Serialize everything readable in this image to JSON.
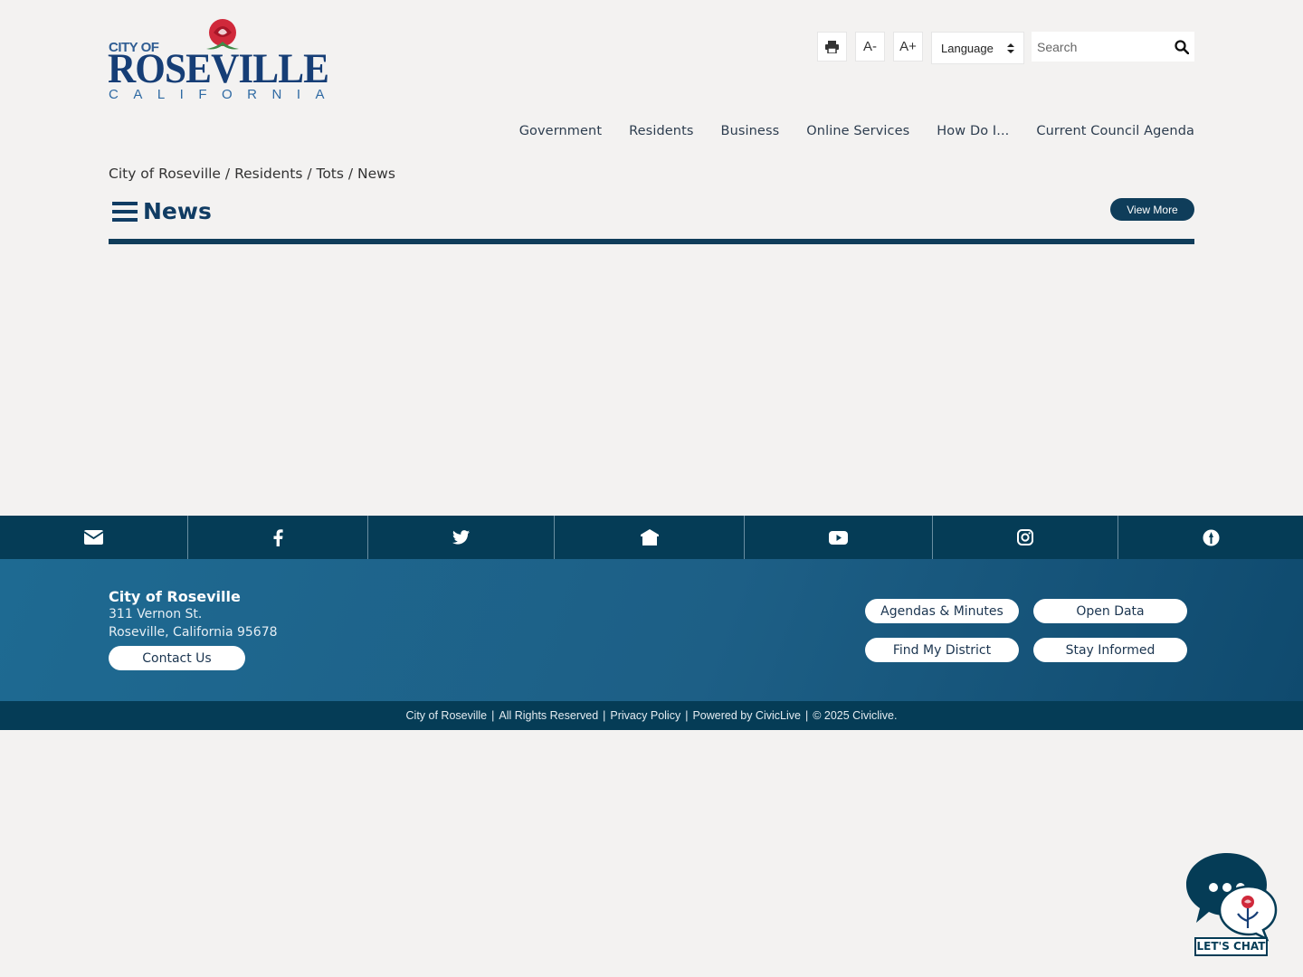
{
  "logo": {
    "line1": "CITY OF",
    "line2": "ROSEVILLE",
    "line3": "CALIFORNIA"
  },
  "toolbar": {
    "print_icon": "print-icon",
    "decrease_text": "A-",
    "increase_text": "A+",
    "language_label": "Language",
    "search_placeholder": "Search",
    "search_icon": "search-icon"
  },
  "nav": {
    "items": [
      {
        "label": "Government"
      },
      {
        "label": "Residents"
      },
      {
        "label": "Business"
      },
      {
        "label": "Online Services"
      },
      {
        "label": "How Do I..."
      },
      {
        "label": "Current Council Agenda"
      }
    ]
  },
  "breadcrumb": {
    "items": [
      "City of Roseville",
      "Residents",
      "Tots",
      "News"
    ],
    "separator": " / "
  },
  "news": {
    "title": "News",
    "view_more": "View More"
  },
  "social": {
    "icons": [
      "envelope-icon",
      "facebook-icon",
      "twitter-icon",
      "nextdoor-icon",
      "youtube-icon",
      "instagram-icon",
      "granicus-icon"
    ]
  },
  "footer": {
    "org_name": "City of Roseville",
    "address_line1": "311 Vernon St.",
    "address_line2": "Roseville, California 95678",
    "contact_button": "Contact Us",
    "links": {
      "agendas": "Agendas & Minutes",
      "open_data": "Open Data",
      "find_district": "Find My District",
      "stay_informed": "Stay Informed"
    }
  },
  "copyright": {
    "org": "City of Roseville",
    "rights": "All Rights Reserved",
    "privacy": "Privacy Policy",
    "powered": "Powered by CivicLive",
    "year": "© 2025 Civiclive."
  },
  "chat": {
    "label": "LET'S CHAT"
  },
  "colors": {
    "navy": "#0f3d5a",
    "footer_blue": "#1e6a92",
    "logo_blue": "#163e76",
    "rose_red": "#d0293b"
  }
}
